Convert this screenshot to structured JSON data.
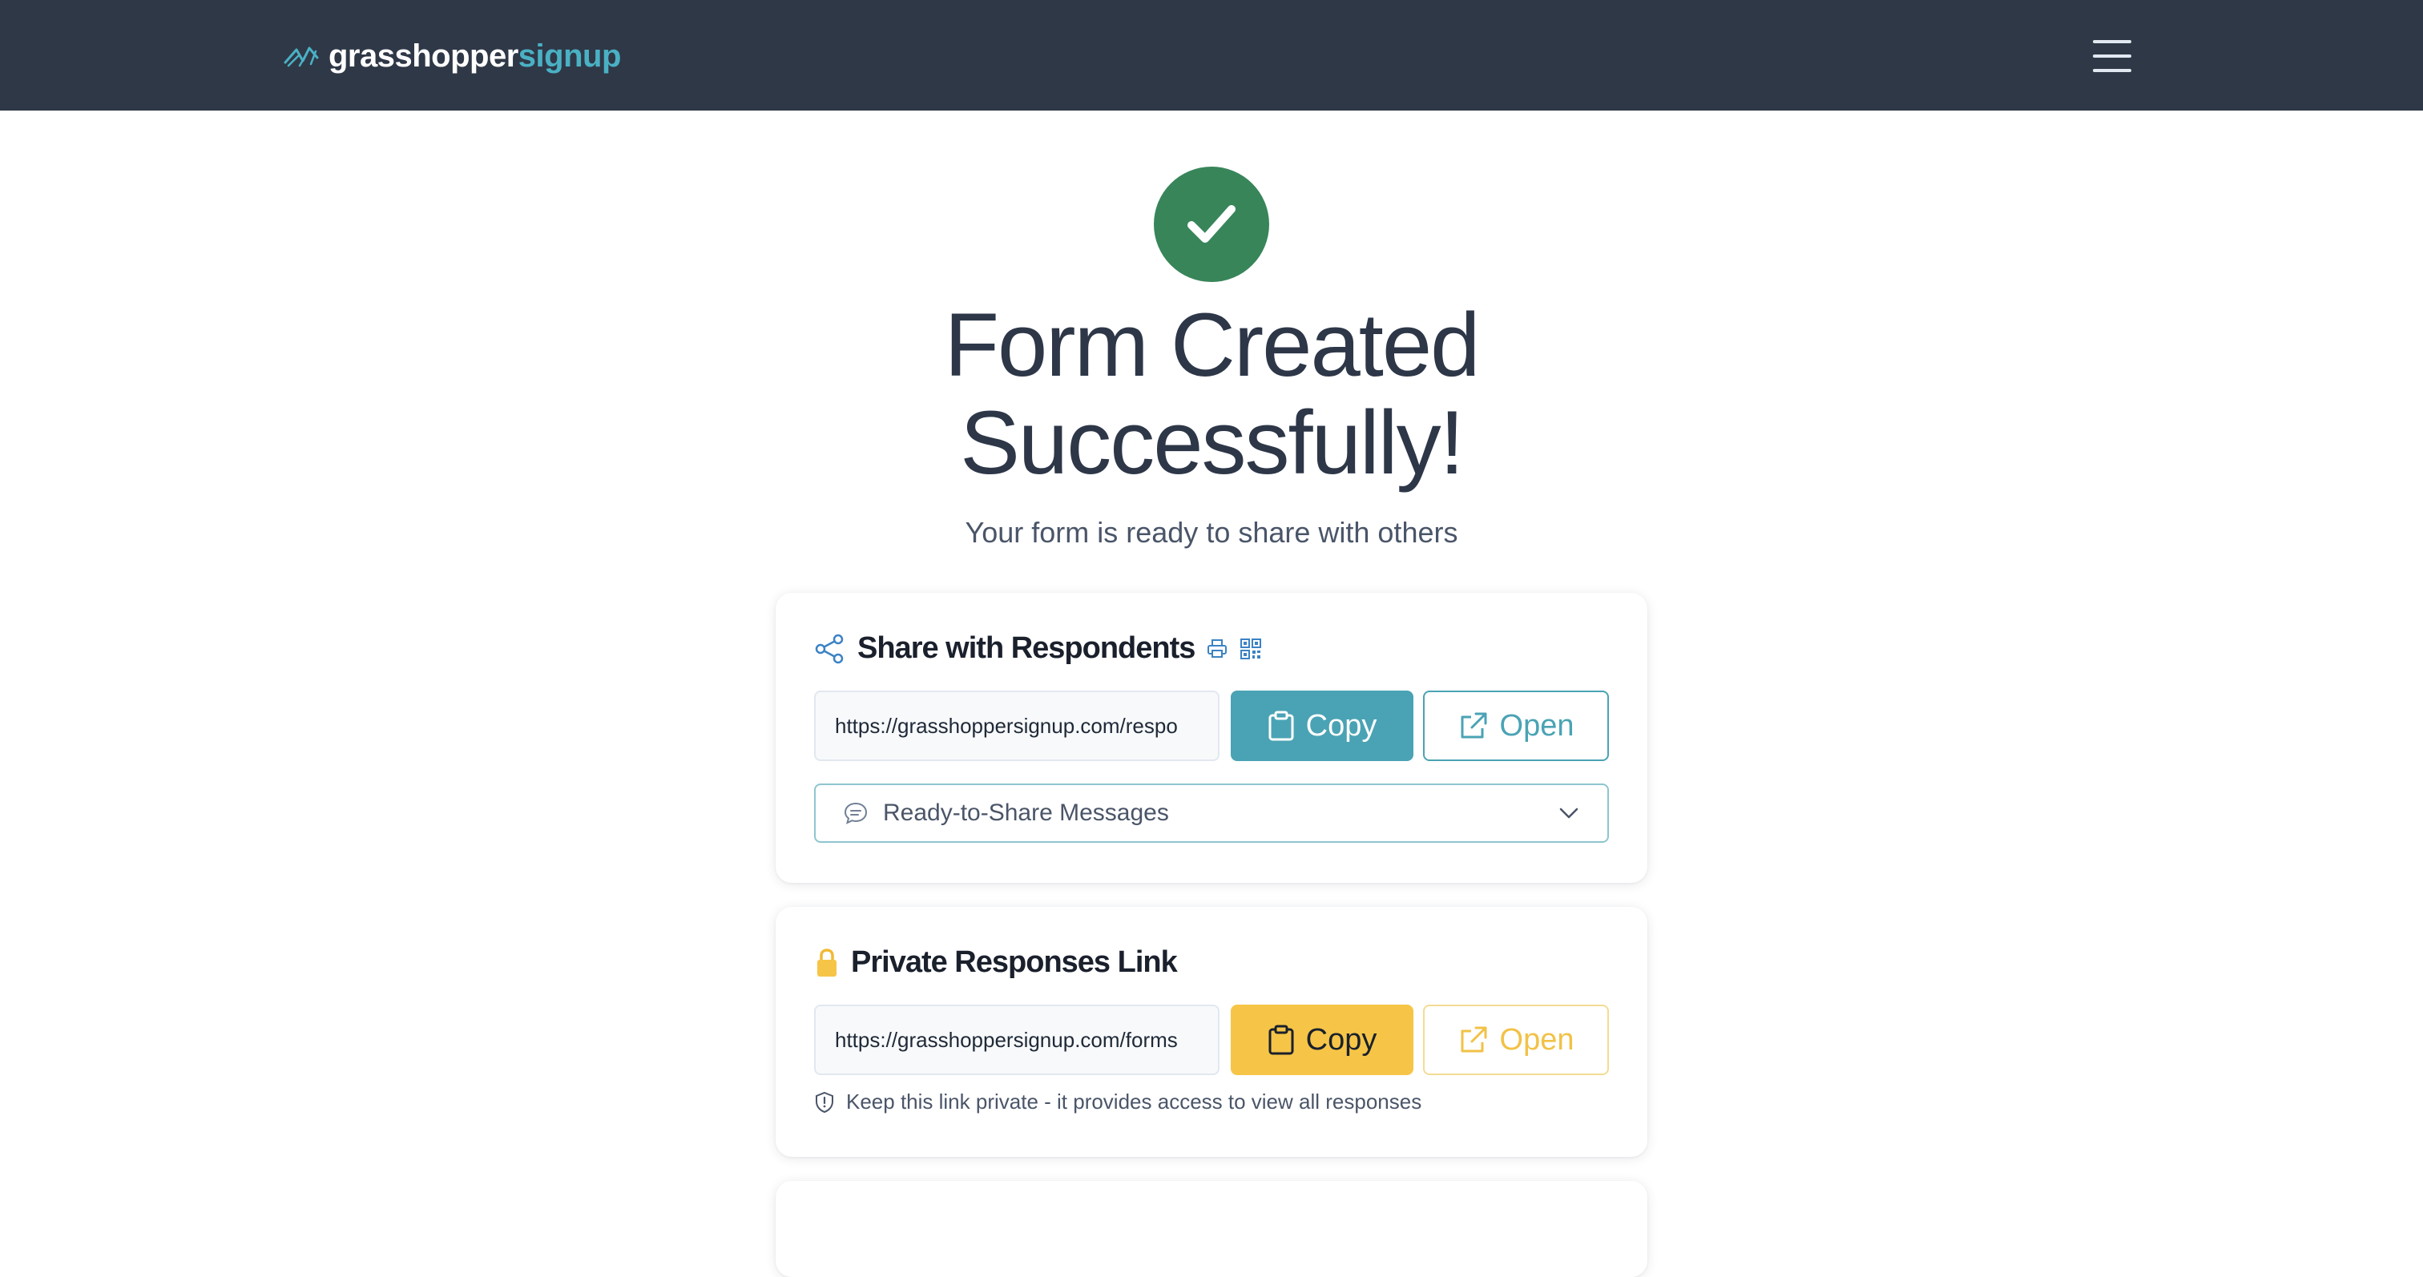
{
  "brand": {
    "name_part1": "grasshopper",
    "name_part2": "signup"
  },
  "success": {
    "title": "Form Created Successfully!",
    "subtitle": "Your form is ready to share with others"
  },
  "share": {
    "title": "Share with Respondents",
    "url": "https://grasshoppersignup.com/respo",
    "copy_label": "Copy",
    "open_label": "Open",
    "messages_label": "Ready-to-Share Messages"
  },
  "private": {
    "title": "Private Responses Link",
    "url": "https://grasshoppersignup.com/forms",
    "copy_label": "Copy",
    "open_label": "Open",
    "note": "Keep this link private - it provides access to view all responses"
  },
  "colors": {
    "navbar": "#2f3847",
    "accent_teal": "#4aa3b4",
    "accent_yellow": "#f6c547",
    "success_green": "#38855a"
  }
}
